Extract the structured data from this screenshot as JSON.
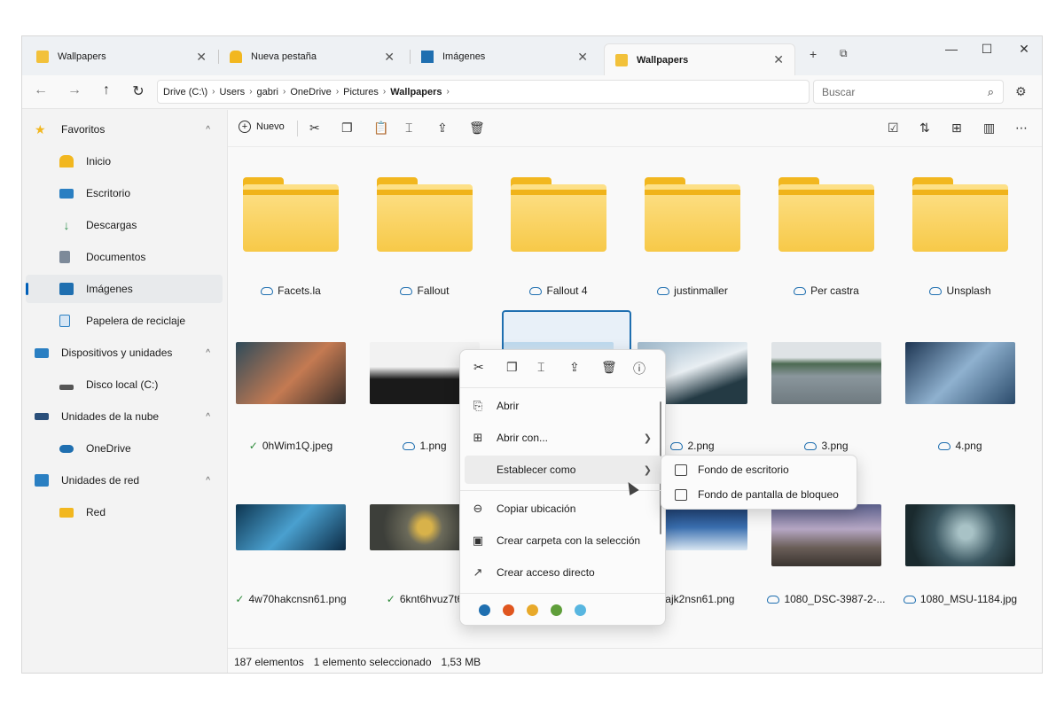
{
  "tabs": [
    {
      "label": "Wallpapers",
      "icon": "folder-icon",
      "active": false
    },
    {
      "label": "Nueva pestaña",
      "icon": "home-icon",
      "active": false
    },
    {
      "label": "Imágenes",
      "icon": "pictures-icon",
      "active": false
    },
    {
      "label": "Wallpapers",
      "icon": "folder-icon",
      "active": true
    }
  ],
  "window_controls": {
    "minimize": "—",
    "maximize": "☐",
    "close": "✕"
  },
  "nav": {
    "back": "←",
    "forward": "→",
    "up": "↑",
    "refresh": "↻"
  },
  "breadcrumb": [
    "Drive (C:\\)",
    "Users",
    "gabri",
    "OneDrive",
    "Pictures",
    "Wallpapers"
  ],
  "search": {
    "placeholder": "Buscar"
  },
  "sidebar": {
    "items": [
      {
        "label": "Favoritos",
        "icon": "star-icon",
        "color": "#f2b71f",
        "expandable": true
      },
      {
        "label": "Inicio",
        "icon": "home-icon",
        "color": "#f2b71f"
      },
      {
        "label": "Escritorio",
        "icon": "desktop-icon",
        "color": "#2a7fc2"
      },
      {
        "label": "Descargas",
        "icon": "download-icon",
        "color": "#2f8f4e"
      },
      {
        "label": "Documentos",
        "icon": "document-icon",
        "color": "#7d8a99"
      },
      {
        "label": "Imágenes",
        "icon": "pictures-icon",
        "color": "#1f6fb0",
        "selected": true
      },
      {
        "label": "Papelera de reciclaje",
        "icon": "recycle-bin-icon",
        "color": "#2a7fc2"
      },
      {
        "label": "Dispositivos y unidades",
        "icon": "monitor-icon",
        "color": "#2a7fc2",
        "expandable": true
      },
      {
        "label": "Disco local (C:)",
        "icon": "drive-icon",
        "color": "#555555"
      },
      {
        "label": "Unidades de la nube",
        "icon": "cloud-drive-icon",
        "color": "#2a4f7a",
        "expandable": true
      },
      {
        "label": "OneDrive",
        "icon": "onedrive-icon",
        "color": "#1f6fb0"
      },
      {
        "label": "Unidades de red",
        "icon": "network-icon",
        "color": "#2a7fc2",
        "expandable": true
      },
      {
        "label": "Red",
        "icon": "folder-icon",
        "color": "#f2b71f"
      }
    ]
  },
  "commandbar": {
    "new_label": "Nuevo"
  },
  "folders": [
    "Facets.la",
    "Fallout",
    "Fallout 4",
    "justinmaller",
    "Per castra",
    "Unsplash"
  ],
  "images_row1": [
    {
      "name": "0hWim1Q.jpeg",
      "status": "synced"
    },
    {
      "name": "1.png",
      "status": "cloud"
    },
    {
      "name": "",
      "status": "selected"
    },
    {
      "name": "2.png",
      "status": "cloud"
    },
    {
      "name": "3.png",
      "status": "cloud"
    },
    {
      "name": "4.png",
      "status": "cloud"
    }
  ],
  "images_row2": [
    {
      "name": "4w70hakcnsn61.png",
      "status": "synced"
    },
    {
      "name": "6knt6hvuz7t6",
      "status": "synced"
    },
    {
      "name": "",
      "status": "hidden"
    },
    {
      "name": "4gfajk2nsn61.png",
      "status": "none"
    },
    {
      "name": "1080_DSC-3987-2-...",
      "status": "cloud"
    },
    {
      "name": "1080_MSU-1184.jpg",
      "status": "cloud"
    }
  ],
  "status": {
    "count": "187 elementos",
    "selection": "1 elemento seleccionado",
    "size": "1,53 MB"
  },
  "context_menu": {
    "top_icons": [
      "cut-icon",
      "copy-icon",
      "rename-icon",
      "share-icon",
      "delete-icon",
      "info-icon"
    ],
    "items": [
      {
        "label": "Abrir",
        "icon": "open-icon"
      },
      {
        "label": "Abrir con...",
        "icon": "open-with-icon",
        "submenu": true
      },
      {
        "label": "Establecer como",
        "icon": "",
        "submenu": true,
        "highlighted": true
      },
      {
        "label": "Copiar ubicación",
        "icon": "link-icon"
      },
      {
        "label": "Crear carpeta con la selección",
        "icon": "new-folder-icon"
      },
      {
        "label": "Crear acceso directo",
        "icon": "shortcut-icon"
      }
    ],
    "tag_colors": [
      "#1f6fb0",
      "#e0561f",
      "#e8a92a",
      "#5f9e3a",
      "#58b6e0"
    ]
  },
  "submenu": {
    "items": [
      {
        "label": "Fondo de escritorio",
        "icon": "wallpaper-icon"
      },
      {
        "label": "Fondo de pantalla de bloqueo",
        "icon": "lockscreen-icon"
      }
    ]
  }
}
